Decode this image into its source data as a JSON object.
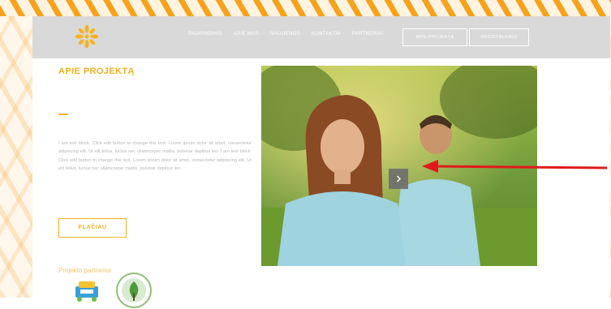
{
  "nav": {
    "links": [
      "PAGRINDINIS",
      "APIE MUS",
      "NAUJIENOS",
      "KONTAKTAI",
      "PARTNERIAI"
    ],
    "buttons": [
      "APIE PROJEKTĄ",
      "REGISTRUOKIS"
    ]
  },
  "about": {
    "title": "APIE PROJEKTĄ",
    "text": "I am text block. Click edit button to change this text. Lorem ipsum dolor sit amet, consectetur adipiscing elit. Ut elit tellus, luctus nec ullamcorper mattis, pulvinar dapibus leo. I am text block. Click edit button to change this text. Lorem ipsum dolor sit amet, consectetur adipiscing elit. Ut elit tellus, luctus nec ullamcorper mattis, pulvinar dapibus leo.",
    "more_button": "PLAČIAU"
  },
  "partners": {
    "title": "Projekto partneriai"
  },
  "colors": {
    "accent": "#f5b21f",
    "navbar": "#d9d9d9",
    "pattern": "#f7a21c",
    "annotation_arrow": "#e01b1b"
  },
  "icons": {
    "logo": "flower-logo",
    "gallery_next": "chevron-right-icon"
  }
}
